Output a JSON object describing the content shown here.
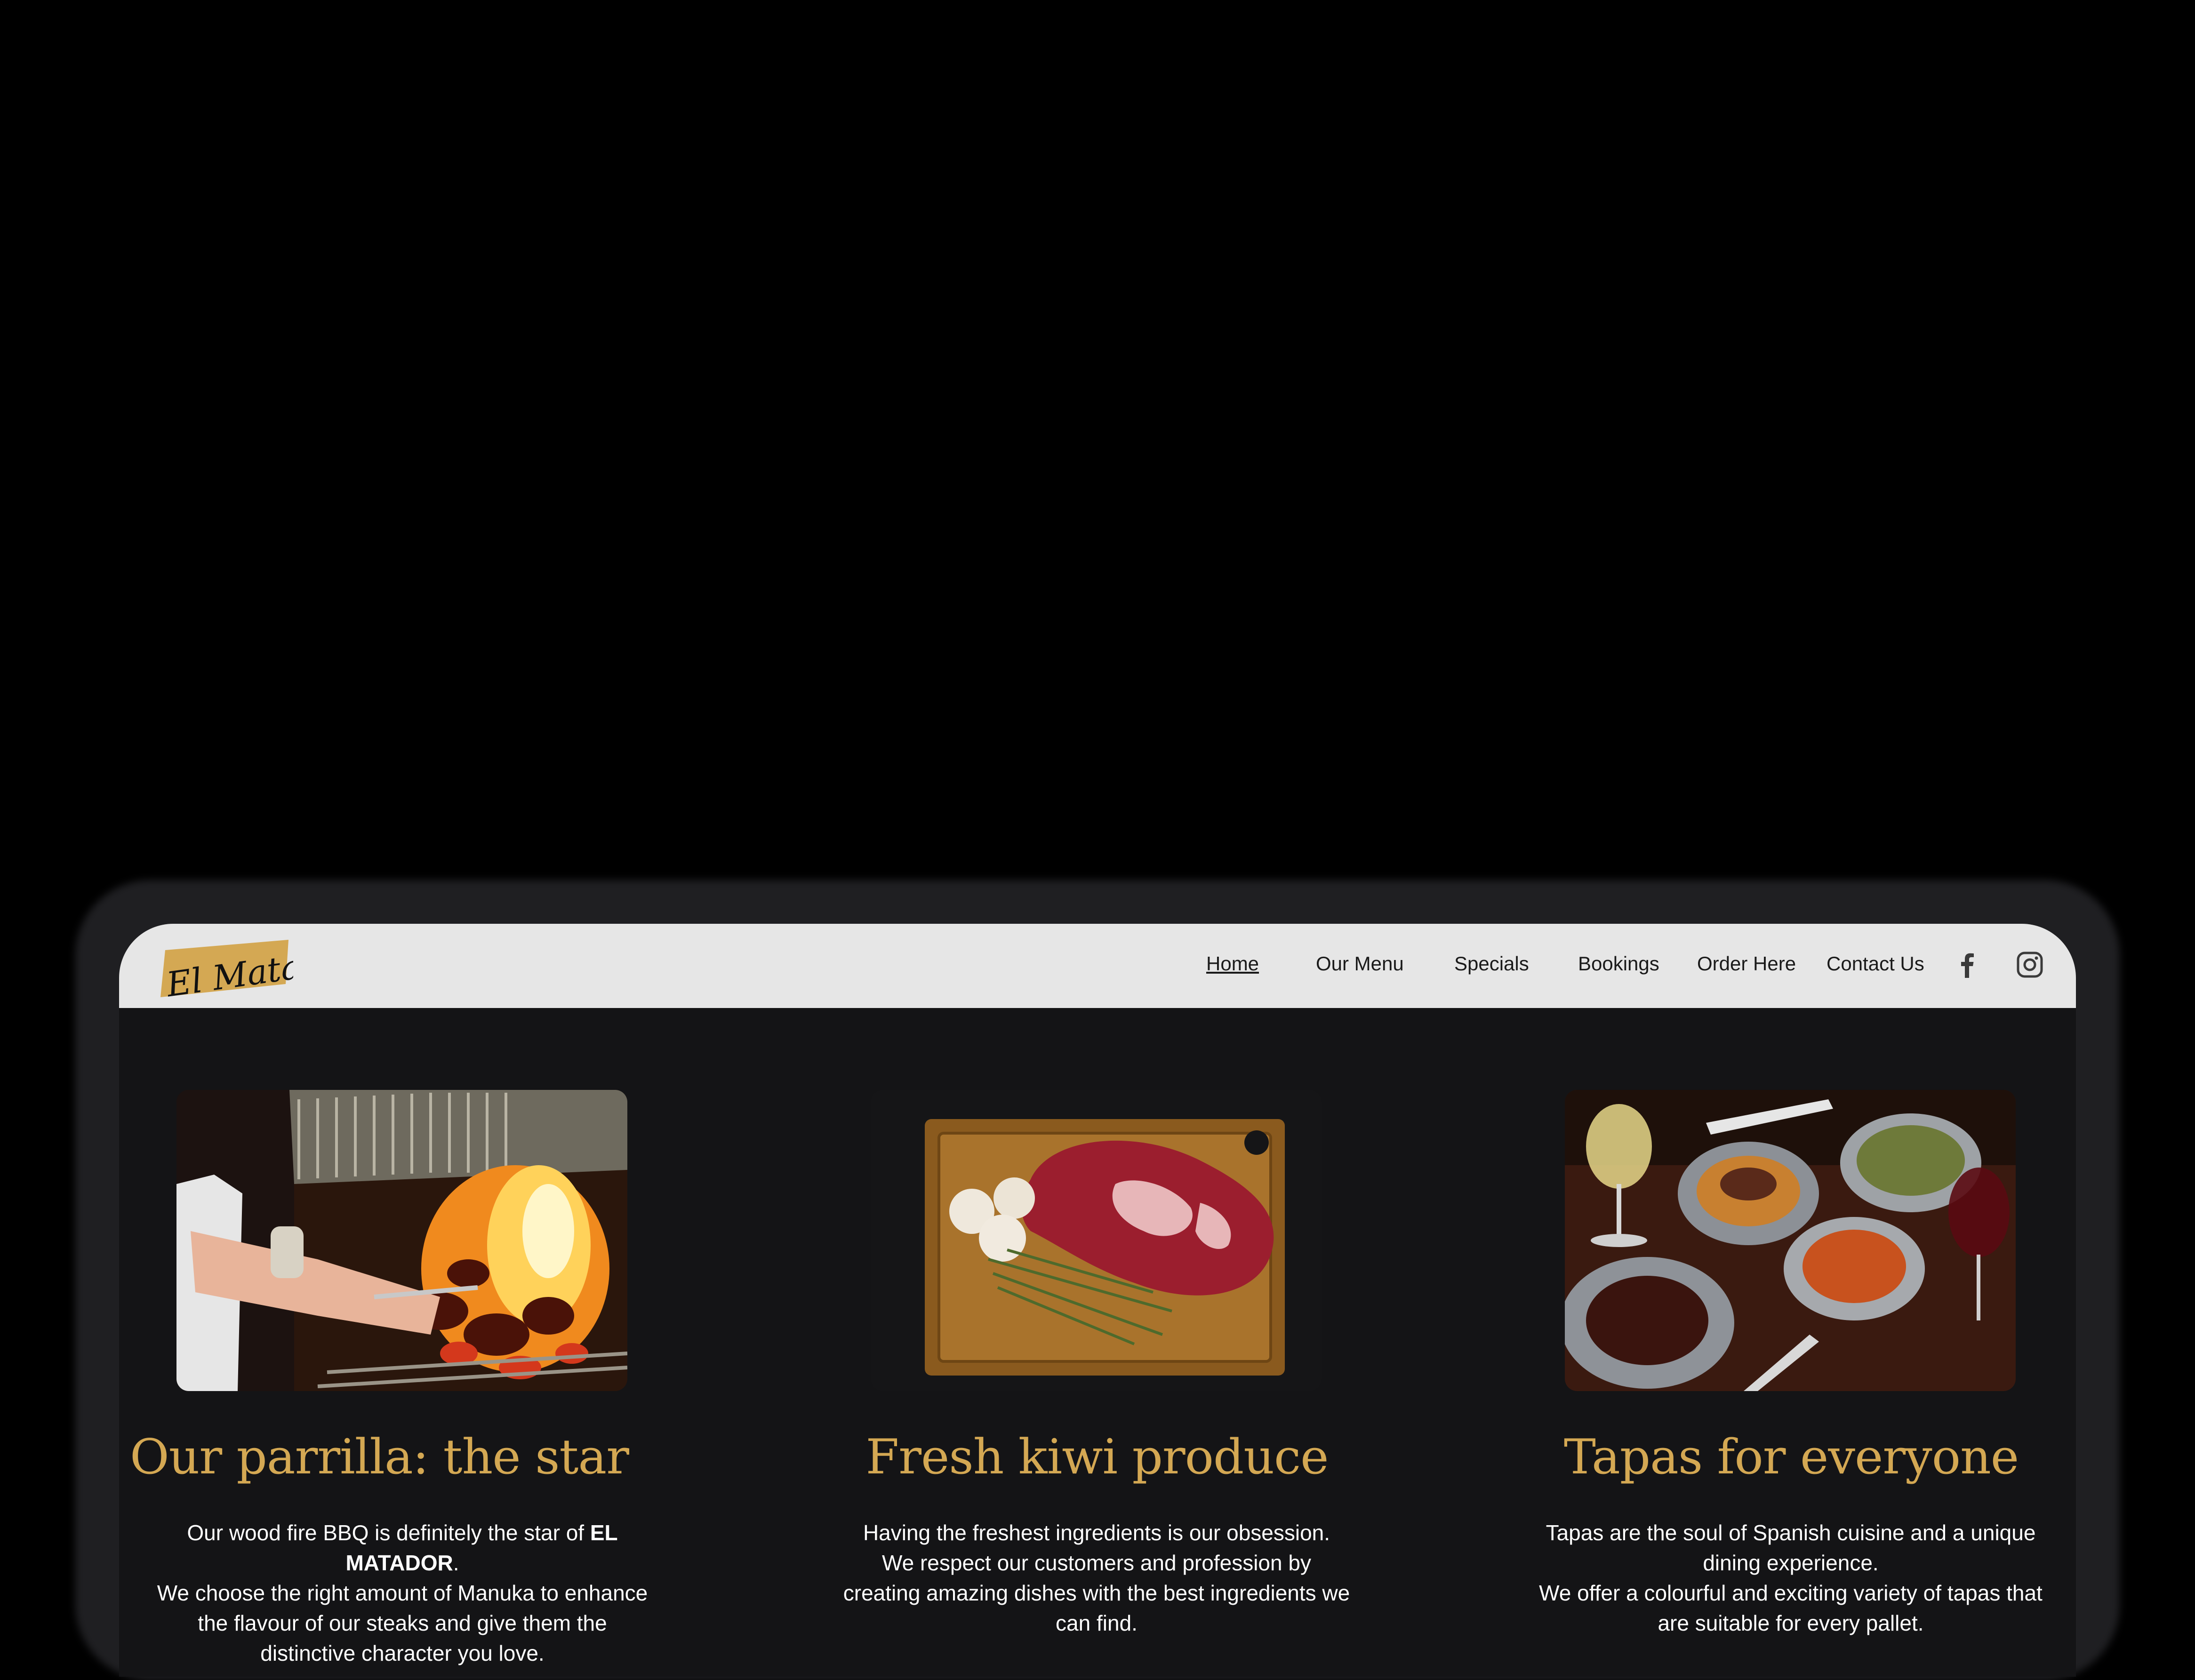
{
  "brand": {
    "logo_text": "El Matador"
  },
  "nav": {
    "items": [
      {
        "label": "Home",
        "active": true
      },
      {
        "label": "Our Menu"
      },
      {
        "label": "Specials"
      },
      {
        "label": "Bookings"
      },
      {
        "label": "Order Here"
      },
      {
        "label": "Contact Us"
      }
    ],
    "social": [
      {
        "icon": "facebook-icon"
      },
      {
        "icon": "instagram-icon"
      }
    ]
  },
  "cards": [
    {
      "image": "parrilla-fire-grill-photo",
      "title": "Our parrilla: the star",
      "text_a": "Our wood fire BBQ is definitely the star of ",
      "text_bold": "EL MATADOR",
      "text_b": ".",
      "text_c": "We choose the right amount of Manuka to enhance the flavour of our steaks and give them the distinctive character you love."
    },
    {
      "image": "raw-steak-cutting-board-photo",
      "title": "Fresh kiwi produce",
      "text_a": "Having the freshest ingredients is our obsession.",
      "text_c": "We respect our customers and profession by creating amazing dishes with the best ingredients we can find."
    },
    {
      "image": "tapas-dishes-table-photo",
      "title": "Tapas for everyone",
      "text_a": "Tapas are the soul of Spanish cuisine and a unique dining experience.",
      "text_c": "We offer a colourful and exciting variety of tapas that are suitable for every pallet."
    }
  ],
  "colors": {
    "background": "#000000",
    "screen_bg": "#141416",
    "navbar_bg": "#e6e6e6",
    "accent_gold": "#d4a853",
    "text_white": "#ffffff",
    "nav_text": "#1a1a1a"
  }
}
